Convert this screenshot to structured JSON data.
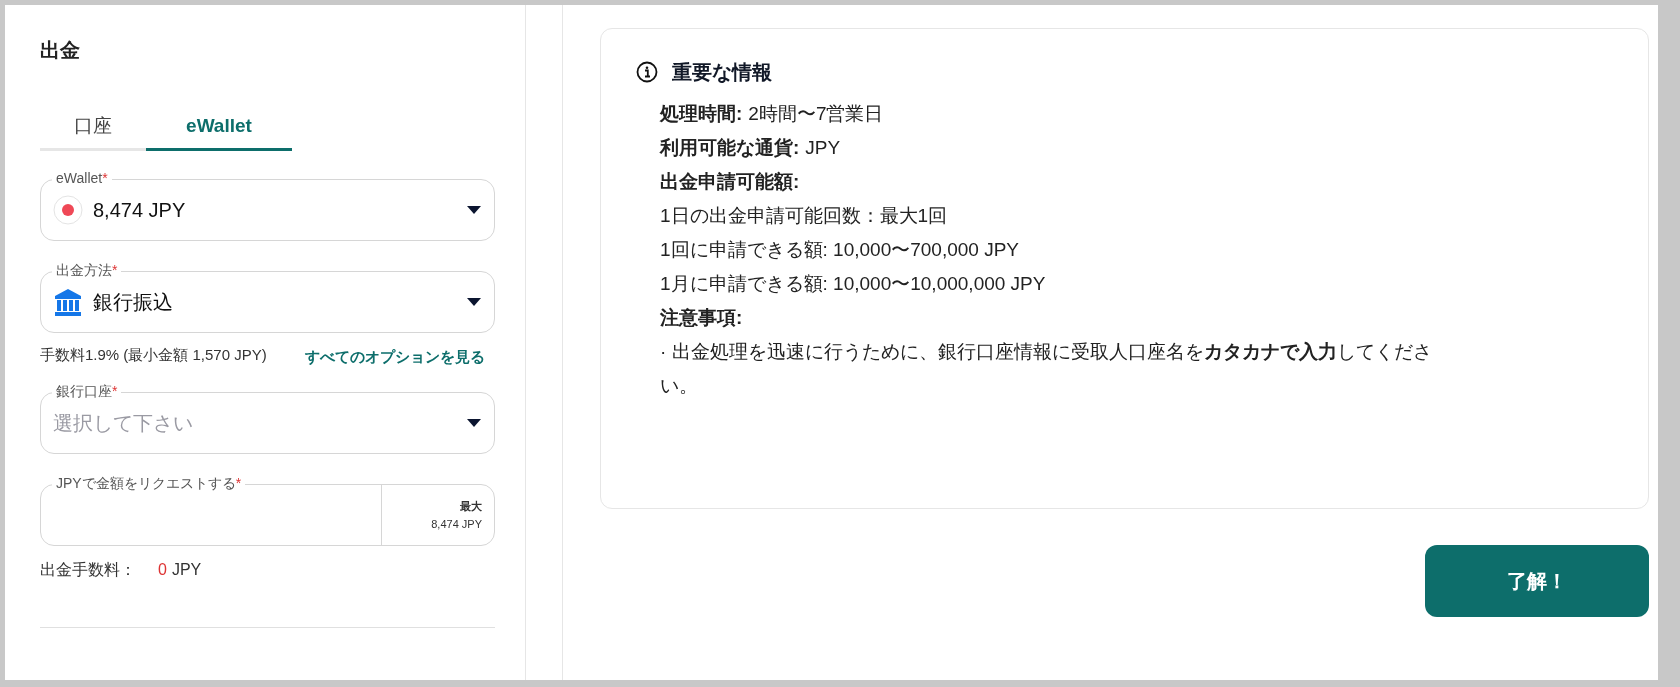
{
  "title": "出金",
  "tabs": [
    {
      "label": "口座",
      "selected": false
    },
    {
      "label": "eWallet",
      "selected": true
    }
  ],
  "wallet": {
    "label": "eWallet",
    "required_mark": "*",
    "value": "8,474 JPY"
  },
  "method": {
    "label": "出金方法",
    "required_mark": "*",
    "value": "銀行振込",
    "fee_note": "手数料1.9% (最小金額 1,570 JPY)",
    "options_link": "すべてのオプションを見る"
  },
  "bank_account": {
    "label": "銀行口座",
    "required_mark": "*",
    "placeholder": "選択して下さい"
  },
  "amount": {
    "label": "JPYで金額をリクエストする",
    "required_mark": "*",
    "max_label": "最大",
    "max_value": "8,474 JPY"
  },
  "fee": {
    "label": "出金手数料：",
    "value": "0",
    "currency": "JPY"
  },
  "info": {
    "title": "重要な情報",
    "lines": [
      {
        "kind": "field",
        "label": "処理時間:",
        "value": "2時間〜7営業日"
      },
      {
        "kind": "field",
        "label": "利用可能な通貨:",
        "value": "JPY"
      },
      {
        "kind": "heading",
        "text": "出金申請可能額:"
      },
      {
        "kind": "text",
        "text": "1日の出金申請可能回数：最大1回"
      },
      {
        "kind": "text",
        "text": "1回に申請できる額: 10,000〜700,000 JPY"
      },
      {
        "kind": "text",
        "text": "1月に申請できる額: 10,000〜10,000,000 JPY"
      },
      {
        "kind": "heading",
        "text": "注意事項:"
      },
      {
        "kind": "text",
        "text": "· 出金処理を迅速に行うために、銀行口座情報に受取人口座名を**カタカナで入力**してください。"
      }
    ]
  },
  "confirm_button": "了解！"
}
